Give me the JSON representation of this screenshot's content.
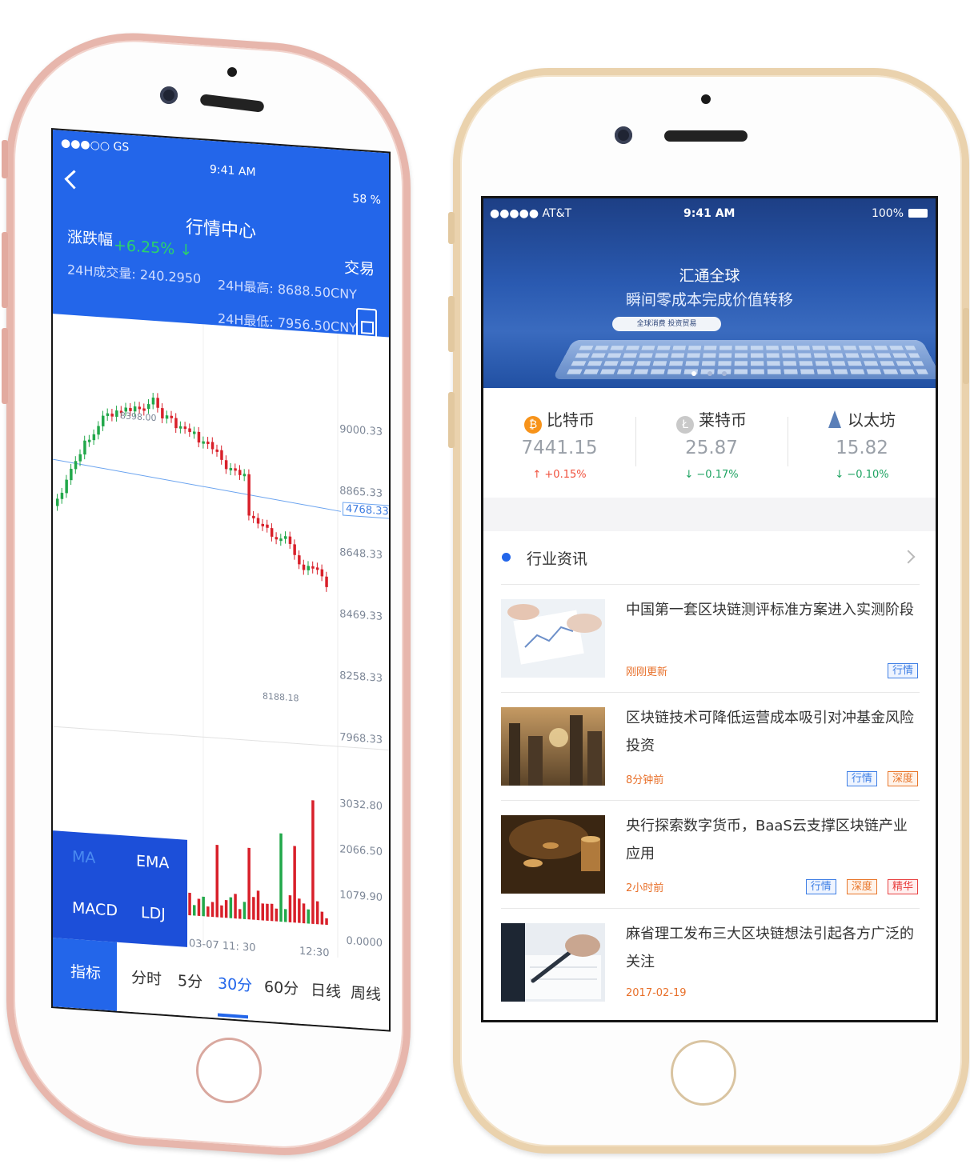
{
  "left_app": {
    "status": {
      "carrier": "●●●○○ GS",
      "time": "9:41 AM",
      "battery": "58 %"
    },
    "nav": {
      "title": "行情中心",
      "action": "交易"
    },
    "summary": {
      "change_label": "涨跌幅",
      "change_value": "+6.25%",
      "volume": "24H成交量: 240.2950",
      "high": "24H最高: 8688.50CNY",
      "low": "24H最低: 7956.50CNY"
    },
    "price_axis": [
      "9000.33",
      "8865.33",
      "8648.33",
      "8469.33",
      "8258.33",
      "7968.33"
    ],
    "price_marker": "4768.33",
    "max_label": "8398.00",
    "min_label": "8188.18",
    "volume_axis": [
      "3032.80",
      "2066.50",
      "1079.90",
      "0.0000"
    ],
    "time_axis": [
      "03-07 11: 30",
      "12:30"
    ],
    "indicators": [
      "MA",
      "EMA",
      "MACD",
      "LDJ"
    ],
    "tabs": [
      "指标",
      "分时",
      "5分",
      "30分",
      "60分",
      "日线",
      "周线"
    ]
  },
  "right_app": {
    "status": {
      "carrier": "●●●●● AT&T",
      "time": "9:41 AM",
      "battery": "100%"
    },
    "banner": {
      "title": "汇通全球",
      "subtitle": "瞬间零成本完成价值转移",
      "tag": "全球消费  投资贸易"
    },
    "coins": [
      {
        "name": "比特币",
        "price": "7441.15",
        "change": "↑ +0.15%",
        "color": "#f0503c"
      },
      {
        "name": "莱特币",
        "price": "25.87",
        "change": "↓ −0.17%",
        "color": "#1ea361"
      },
      {
        "name": "以太坊",
        "price": "15.82",
        "change": "↓ −0.10%",
        "color": "#1ea361"
      }
    ],
    "section_title": "行业资讯",
    "news": [
      {
        "title": "中国第一套区块链测评标准方案进入实测阶段",
        "time": "刚刚更新",
        "tags": [
          "行情"
        ]
      },
      {
        "title": "区块链技术可降低运营成本吸引对冲基金风险投资",
        "time": "8分钟前",
        "tags": [
          "行情",
          "深度"
        ]
      },
      {
        "title": "央行探索数字货币，BaaS云支撑区块链产业应用",
        "time": "2小时前",
        "tags": [
          "行情",
          "深度",
          "精华"
        ]
      },
      {
        "title": "麻省理工发布三大区块链想法引起各方广泛的关注",
        "time": "2017-02-19",
        "tags": []
      }
    ]
  }
}
